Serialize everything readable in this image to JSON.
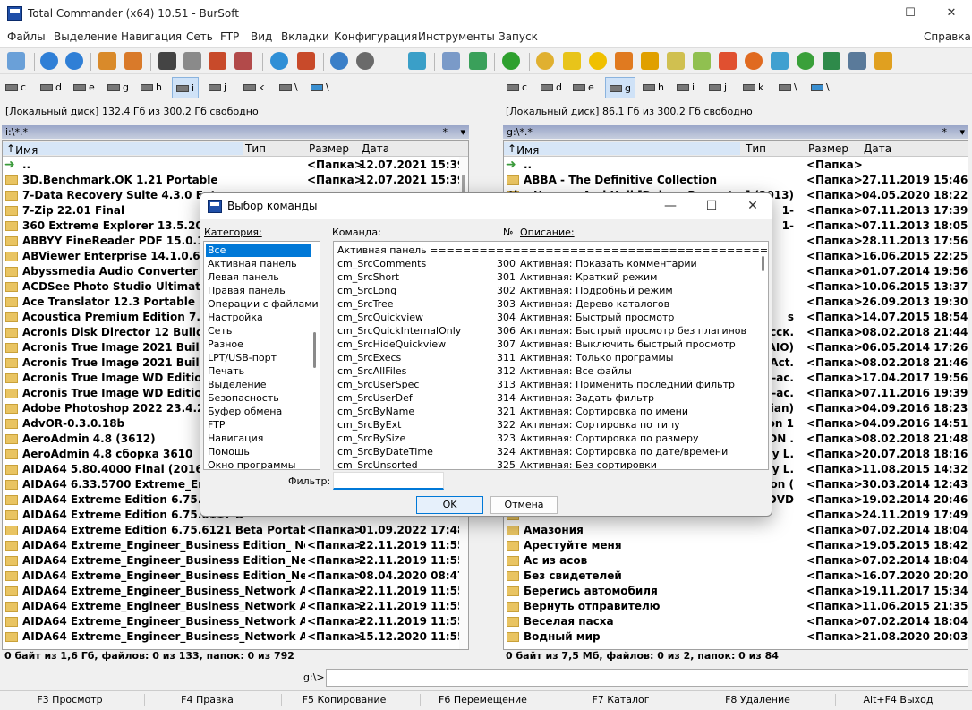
{
  "window": {
    "title": "Total Commander (x64) 10.51 - BurSoft",
    "minimize": "—",
    "maximize": "☐",
    "close": "✕"
  },
  "menu": [
    "Файлы",
    "Выделение",
    "Навигация",
    "Сеть",
    "FTP",
    "Вид",
    "Вкладки",
    "Конфигурация",
    "Инструменты",
    "Запуск"
  ],
  "menu_help": "Справка",
  "left": {
    "drives": [
      "c",
      "d",
      "e",
      "g",
      "h",
      "i",
      "j",
      "k",
      "\\",
      "\\"
    ],
    "selected_drive": "i",
    "disk_info": "[Локальный диск]  132,4 Гб из 300,2 Гб свободно",
    "path": "i:\\*.*",
    "path_star": "*",
    "path_arrow": "▾",
    "headers": {
      "name": "Имя",
      "type": "Тип",
      "size": "Размер",
      "date": "Дата"
    },
    "files": [
      {
        "name": "..",
        "size": "<Папка>",
        "date": "12.07.2021 15:39",
        "up": true
      },
      {
        "name": "3D.Benchmark.OK 1.21 Portable",
        "size": "<Папка>",
        "date": "12.07.2021 15:39"
      },
      {
        "name": "7-Data Recovery Suite 4.3.0 Enterp",
        "size": "",
        "date": ""
      },
      {
        "name": "7-Zip 22.01 Final",
        "size": "",
        "date": ""
      },
      {
        "name": "360 Extreme Explorer 13.5.2022.0 Fi",
        "size": "",
        "date": ""
      },
      {
        "name": "ABBYY FineReader PDF 15.0.114.468",
        "size": "",
        "date": ""
      },
      {
        "name": "ABViewer Enterprise 14.1.0.69 RePa",
        "size": "",
        "date": ""
      },
      {
        "name": "Abyssmedia Audio Converter Plus 6",
        "size": "",
        "date": ""
      },
      {
        "name": "ACDSee Photo Studio Ultimate 2021",
        "size": "",
        "date": ""
      },
      {
        "name": "Ace Translator 12.3 Portable by Dril",
        "size": "",
        "date": ""
      },
      {
        "name": "Acoustica Premium Edition 7.3.0 Re",
        "size": "",
        "date": ""
      },
      {
        "name": "Acronis Disk Director 12 Build 12.5.1",
        "size": "",
        "date": ""
      },
      {
        "name": "Acronis True Image 2021 Build 3434",
        "size": "",
        "date": ""
      },
      {
        "name": "Acronis True Image 2021 Build 3580",
        "size": "",
        "date": ""
      },
      {
        "name": "Acronis True Image WD Edition 19.",
        "size": "",
        "date": ""
      },
      {
        "name": "Acronis True Image WD Edition 202",
        "size": "",
        "date": ""
      },
      {
        "name": "Adobe Photoshop 2022 23.4.2.603 R",
        "size": "",
        "date": ""
      },
      {
        "name": "AdvOR-0.3.0.18b",
        "size": "",
        "date": ""
      },
      {
        "name": "AeroAdmin 4.8 (3612)",
        "size": "",
        "date": ""
      },
      {
        "name": "AeroAdmin 4.8 сборка 3610",
        "size": "",
        "date": ""
      },
      {
        "name": "AIDA64 5.80.4000 Final (2016) PC",
        "size": "",
        "date": ""
      },
      {
        "name": "AIDA64 6.33.5700 Extreme_Enginee",
        "size": "",
        "date": ""
      },
      {
        "name": "AIDA64 Extreme Edition 6.75.6115 B",
        "size": "",
        "date": ""
      },
      {
        "name": "AIDA64 Extreme Edition 6.75.6117 B",
        "size": "",
        "date": ""
      },
      {
        "name": "AIDA64 Extreme Edition 6.75.6121 Beta Portable",
        "size": "<Папка>",
        "date": "01.09.2022 17:48"
      },
      {
        "name": "AIDA64 Extreme_Engineer_Business Edition_ Network ...",
        "size": "<Папка>",
        "date": "22.11.2019 11:55"
      },
      {
        "name": "AIDA64 Extreme_Engineer_Business Edition_Network ...",
        "size": "<Папка>",
        "date": "22.11.2019 11:55"
      },
      {
        "name": "AIDA64 Extreme_Engineer_Business Edition_Network ...",
        "size": "<Папка>",
        "date": "08.04.2020 08:47"
      },
      {
        "name": "AIDA64 Extreme_Engineer_Business_Network Audit 5...",
        "size": "<Папка>",
        "date": "22.11.2019 11:55"
      },
      {
        "name": "AIDA64 Extreme_Engineer_Business_Network Audit 5...",
        "size": "<Папка>",
        "date": "22.11.2019 11:55"
      },
      {
        "name": "AIDA64 Extreme_Engineer_Business_Network Audit 5...",
        "size": "<Папка>",
        "date": "22.11.2019 11:55"
      },
      {
        "name": "AIDA64 Extreme_Engineer_Business_Network Audit 6...",
        "size": "<Папка>",
        "date": "15.12.2020 11:55"
      }
    ],
    "status": "0 байт из 1,6 Гб, файлов: 0 из 133, папок: 0 из 792"
  },
  "right": {
    "drives": [
      "c",
      "d",
      "e",
      "g",
      "h",
      "i",
      "j",
      "k",
      "\\",
      "\\"
    ],
    "selected_drive": "g",
    "disk_info": "[Локальный диск]  86,1 Гб из 300,2 Гб свободно",
    "path": "g:\\*.*",
    "path_star": "*",
    "path_arrow": "▾",
    "headers": {
      "name": "Имя",
      "type": "Тип",
      "size": "Размер",
      "date": "Дата"
    },
    "files": [
      {
        "name": "..",
        "size": "<Папка>",
        "date": "",
        "up": true
      },
      {
        "name": "ABBA - The Definitive Collection",
        "size": "<Папка>",
        "date": "27.11.2019 15:46"
      },
      {
        "name": "",
        "size": "<Папка>",
        "date": "04.05.2020 18:22"
      },
      {
        "name": "",
        "size": "<Папка>",
        "date": "07.11.2013 17:39"
      },
      {
        "name": "",
        "size": "<Папка>",
        "date": "07.11.2013 18:05"
      },
      {
        "name": "",
        "size": "<Папка>",
        "date": "28.11.2013 17:56"
      },
      {
        "name": "",
        "size": "<Папка>",
        "date": "16.06.2015 22:25"
      },
      {
        "name": "",
        "size": "<Папка>",
        "date": "01.07.2014 19:56"
      },
      {
        "name": "",
        "size": "<Папка>",
        "date": "10.06.2015 13:37"
      },
      {
        "name": "",
        "size": "<Папка>",
        "date": "26.09.2013 19:30"
      },
      {
        "name": "",
        "size": "<Папка>",
        "date": "14.07.2015 18:54"
      },
      {
        "name": "",
        "size": "<Папка>",
        "date": "08.02.2018 21:44"
      },
      {
        "name": "",
        "size": "<Папка>",
        "date": "06.05.2014 17:26"
      },
      {
        "name": "",
        "size": "<Папка>",
        "date": "08.02.2018 21:46"
      },
      {
        "name": "",
        "size": "<Папка>",
        "date": "17.04.2017 19:56"
      },
      {
        "name": "",
        "size": "<Папка>",
        "date": "07.11.2016 19:39"
      },
      {
        "name": "",
        "size": "<Папка>",
        "date": "04.09.2016 18:23"
      },
      {
        "name": "",
        "size": "<Папка>",
        "date": "04.09.2016 14:51"
      },
      {
        "name": "",
        "size": "<Папка>",
        "date": "08.02.2018 21:48"
      },
      {
        "name": "",
        "size": "<Папка>",
        "date": "20.07.2018 18:16"
      },
      {
        "name": "",
        "size": "<Папка>",
        "date": "11.08.2015 14:32"
      },
      {
        "name": "",
        "size": "<Папка>",
        "date": "30.03.2014 12:43"
      },
      {
        "name": "",
        "size": "<Папка>",
        "date": "19.02.2014 20:46"
      },
      {
        "name": "",
        "size": "<Папка>",
        "date": "24.11.2019 17:49"
      },
      {
        "name": "Амазония",
        "size": "<Папка>",
        "date": "07.02.2014 18:04"
      },
      {
        "name": "Арестуйте меня",
        "size": "<Папка>",
        "date": "19.05.2015 18:42"
      },
      {
        "name": "Ас из асов",
        "size": "<Папка>",
        "date": "07.02.2014 18:04"
      },
      {
        "name": "Без свидетелей",
        "size": "<Папка>",
        "date": "16.07.2020 20:20"
      },
      {
        "name": "Берегись автомобиля",
        "size": "<Папка>",
        "date": "19.11.2017 15:34"
      },
      {
        "name": "Вернуть отправителю",
        "size": "<Папка>",
        "date": "11.06.2015 21:35"
      },
      {
        "name": "Веселая пасха",
        "size": "<Папка>",
        "date": "07.02.2014 18:04"
      },
      {
        "name": "Водный мир",
        "size": "<Папка>",
        "date": "21.08.2020 20:03"
      }
    ],
    "partial_names": [
      "Black Sabbath - Heaven And Hell [Deluxe Remast...] (2013)",
      "1-",
      "1-",
      "",
      "",
      "",
      "",
      "",
      "s",
      "(русск.",
      "AIO)",
      "- Act.",
      "S-ac.",
      "S-ac.",
      "ssian)",
      "ion 1",
      "SDN .",
      "by L.",
      "by L.",
      "tion (",
      "N.DVD"
    ],
    "status": "0 байт из 7,5 Мб, файлов: 0 из 2, папок: 0 из 84"
  },
  "cmdline": {
    "label": "g:\\>",
    "value": ""
  },
  "fkeys": [
    "F3 Просмотр",
    "F4 Правка",
    "F5 Копирование",
    "F6 Перемещение",
    "F7 Каталог",
    "F8 Удаление",
    "Alt+F4 Выход"
  ],
  "dialog": {
    "title": "Выбор команды",
    "minimize": "—",
    "maximize": "☐",
    "close": "✕",
    "category_label": "Категория:",
    "command_label": "Команда:",
    "number_label": "№",
    "description_label": "Описание:",
    "categories": [
      "Все",
      "Активная панель",
      "Левая панель",
      "Правая панель",
      "Операции с файлами",
      "Настройка",
      "Сеть",
      "Разное",
      "LPT/USB-порт",
      "Печать",
      "Выделение",
      "Безопасность",
      "Буфер обмена",
      "FTP",
      "Навигация",
      "Помощь",
      "Окно программы"
    ],
    "selected_category": "Все",
    "commands_header": "Активная панель ================================================",
    "commands": [
      {
        "cmd": "cm_SrcComments",
        "num": "300",
        "desc": "Активная: Показать комментарии"
      },
      {
        "cmd": "cm_SrcShort",
        "num": "301",
        "desc": "Активная: Краткий режим"
      },
      {
        "cmd": "cm_SrcLong",
        "num": "302",
        "desc": "Активная: Подробный режим"
      },
      {
        "cmd": "cm_SrcTree",
        "num": "303",
        "desc": "Активная: Дерево каталогов"
      },
      {
        "cmd": "cm_SrcQuickview",
        "num": "304",
        "desc": "Активная: Быстрый просмотр"
      },
      {
        "cmd": "cm_SrcQuickInternalOnly",
        "num": "306",
        "desc": "Активная: Быстрый просмотр без плагинов"
      },
      {
        "cmd": "cm_SrcHideQuickview",
        "num": "307",
        "desc": "Активная: Выключить быстрый просмотр"
      },
      {
        "cmd": "cm_SrcExecs",
        "num": "311",
        "desc": "Активная: Только программы"
      },
      {
        "cmd": "cm_SrcAllFiles",
        "num": "312",
        "desc": "Активная: Все файлы"
      },
      {
        "cmd": "cm_SrcUserSpec",
        "num": "313",
        "desc": "Активная: Применить последний фильтр"
      },
      {
        "cmd": "cm_SrcUserDef",
        "num": "314",
        "desc": "Активная: Задать фильтр"
      },
      {
        "cmd": "cm_SrcByName",
        "num": "321",
        "desc": "Активная: Сортировка по имени"
      },
      {
        "cmd": "cm_SrcByExt",
        "num": "322",
        "desc": "Активная: Сортировка по типу"
      },
      {
        "cmd": "cm_SrcBySize",
        "num": "323",
        "desc": "Активная: Сортировка по размеру"
      },
      {
        "cmd": "cm_SrcByDateTime",
        "num": "324",
        "desc": "Активная: Сортировка по дате/времени"
      },
      {
        "cmd": "cm_SrcUnsorted",
        "num": "325",
        "desc": "Активная: Без сортировки"
      }
    ],
    "filter_label": "Фильтр:",
    "filter_value": "",
    "ok": "OK",
    "cancel": "Отмена"
  }
}
